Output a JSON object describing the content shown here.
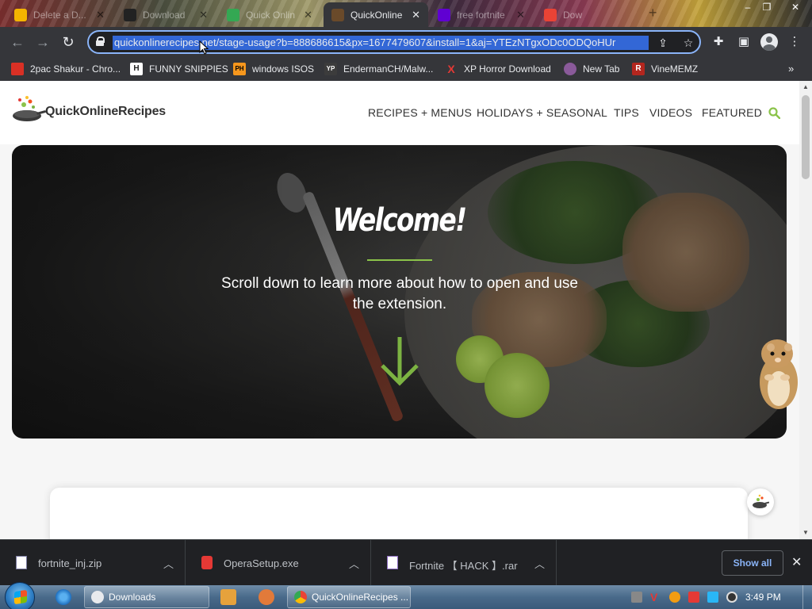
{
  "browser": {
    "tabs": [
      {
        "label": "Delete a D...",
        "active": false,
        "color": "#f4b400"
      },
      {
        "label": "Download",
        "active": false,
        "color": "#222222"
      },
      {
        "label": "Quick Onlin",
        "active": false,
        "color": "#34a853"
      },
      {
        "label": "QuickOnline",
        "active": true,
        "color": "#6a4a2a"
      },
      {
        "label": "free fortnite",
        "active": false,
        "color": "#6001d2"
      },
      {
        "label": "Dow",
        "active": false,
        "color": "#ea4335"
      }
    ],
    "url": "quickonlinerecipes.net/stage-usage?b=888686615&px=1677479607&install=1&aj=YTEzNTgxODc0ODQoHUr",
    "bookmarks": [
      {
        "label": "2pac Shakur - Chro...",
        "icon": "red-bag-icon",
        "color": "#d93025",
        "glyph": ""
      },
      {
        "label": "FUNNY SNIPPIES",
        "icon": "h-icon",
        "color": "#222222",
        "glyph": "H"
      },
      {
        "label": "windows ISOS",
        "icon": "ph-icon",
        "color": "#f7971d",
        "glyph": "PH"
      },
      {
        "label": "EndermanCH/Malw...",
        "icon": "yp-icon",
        "color": "#3c3c3c",
        "glyph": "YP"
      },
      {
        "label": "XP Horror Download",
        "icon": "x-icon",
        "color": "#35363a",
        "glyph": "X"
      },
      {
        "label": "New Tab",
        "icon": "globe-icon",
        "color": "#8a5a9a",
        "glyph": ""
      },
      {
        "label": "VineMEMZ",
        "icon": "r-icon",
        "color": "#b3261e",
        "glyph": "R"
      }
    ]
  },
  "site": {
    "logo_text": "QuickOnlineRecipes",
    "nav": [
      "RECIPES + MENUS",
      "HOLIDAYS + SEASONAL",
      "TIPS",
      "VIDEOS",
      "FEATURED"
    ],
    "accent": "#8bc34a",
    "hero": {
      "title": "Welcome!",
      "text": "Scroll down to learn more about how to open and use the extension."
    }
  },
  "downloads": {
    "items": [
      {
        "name": "fortnite_inj.zip",
        "icon": "zip-file-icon"
      },
      {
        "name": "OperaSetup.exe",
        "icon": "opera-setup-icon"
      },
      {
        "name": "Fortnite 【 HACK 】.rar",
        "icon": "rar-file-icon"
      }
    ],
    "show_all": "Show all"
  },
  "taskbar": {
    "windows": [
      {
        "label": "Downloads",
        "icon": "folder-icon"
      },
      {
        "label": "QuickOnlineRecipes ...",
        "icon": "chrome-icon"
      }
    ],
    "clock": "3:49 PM"
  }
}
